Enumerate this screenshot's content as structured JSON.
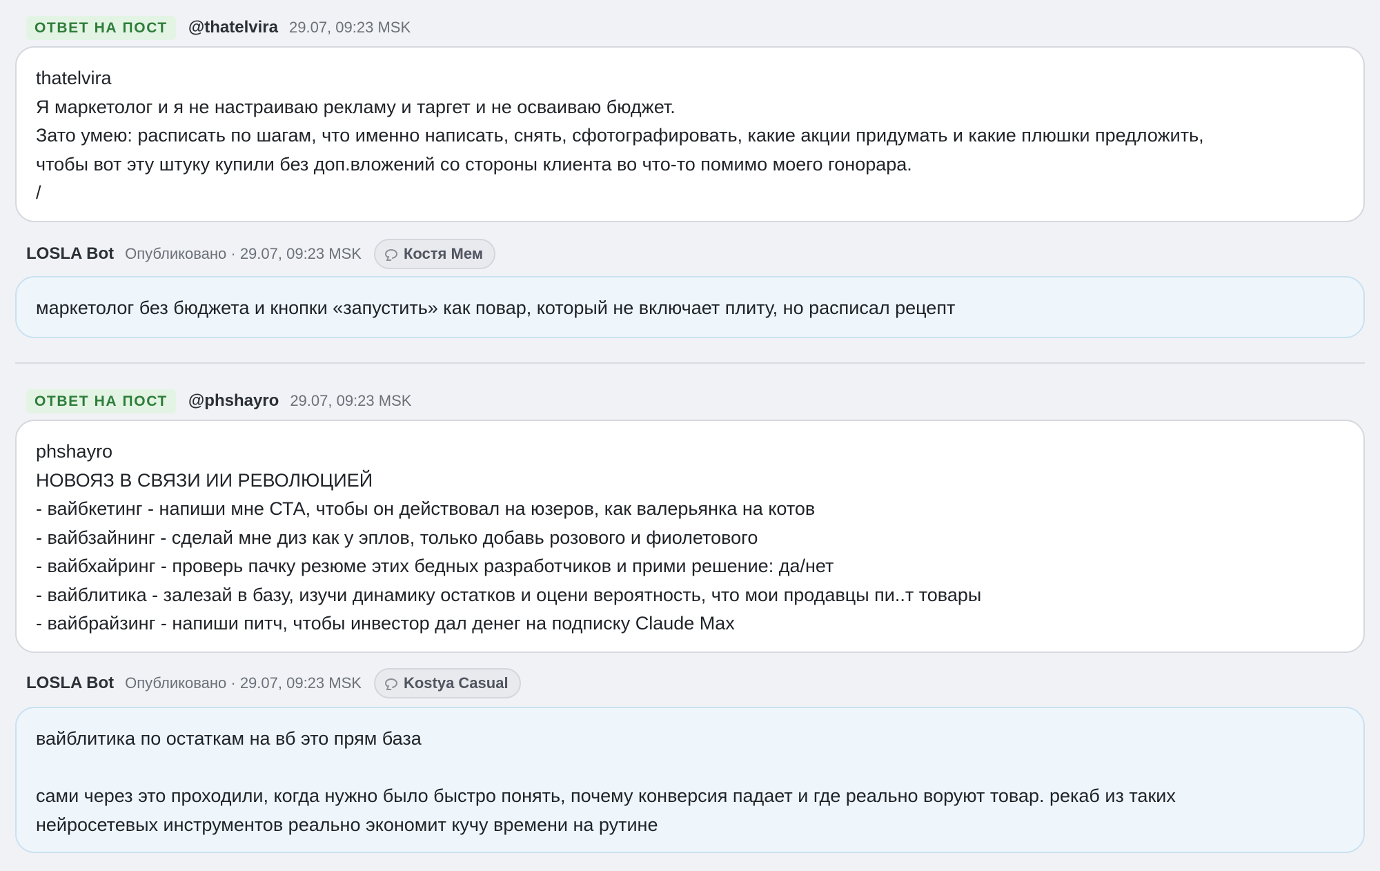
{
  "threads": [
    {
      "post": {
        "tag": "ОТВЕТ НА ПОСТ",
        "handle": "@thatelvira",
        "time": "29.07, 09:23 MSK",
        "lines": [
          "thatelvira",
          "Я маркетолог и я не настраиваю рекламу и таргет и не осваиваю бюджет.",
          "Зато умею: расписать по шагам, что именно написать, снять, сфотографировать, какие акции придумать и какие плюшки предложить,",
          "чтобы вот эту штуку купили без доп.вложений со стороны клиента во что-то помимо моего гонорара.",
          "/"
        ]
      },
      "reply": {
        "bot_name": "LOSLA Bot",
        "meta": "Опубликовано · 29.07, 09:23 MSK",
        "persona": "Костя Мем",
        "persona_icon": "chat-bubble-icon",
        "lines": [
          "маркетолог без бюджета и кнопки «запустить» как повар, который не включает плиту, но расписал рецепт"
        ]
      }
    },
    {
      "post": {
        "tag": "ОТВЕТ НА ПОСТ",
        "handle": "@phshayro",
        "time": "29.07, 09:23 MSK",
        "lines": [
          "phshayro",
          "НОВОЯЗ В СВЯЗИ ИИ РЕВОЛЮЦИЕЙ",
          "- вайбкетинг - напиши мне СТА, чтобы он действовал на юзеров, как валерьянка на котов",
          "- вайбзайнинг - сделай мне диз как у эплов, только добавь розового и фиолетового",
          "- вайбхайринг - проверь пачку резюме этих бедных разработчиков и прими решение: да/нет",
          "- вайблитика - залезай в базу, изучи динамику остатков и оцени вероятность, что мои продавцы пи..т товары",
          "- вайбрайзинг - напиши питч, чтобы инвестор дал денег на подписку Claude Max"
        ]
      },
      "reply": {
        "bot_name": "LOSLA Bot",
        "meta": "Опубликовано · 29.07, 09:23 MSK",
        "persona": "Kostya Casual",
        "persona_icon": "chat-bubble-icon",
        "lines": [
          "вайблитика по остаткам на вб это прям база",
          "",
          "сами через это проходили, когда нужно было быстро понять, почему конверсия падает и где реально воруют товар. рекаб из таких",
          "нейросетевых инструментов реально экономит кучу времени на рутине"
        ]
      }
    }
  ],
  "colors": {
    "page_bg": "#f1f2f5",
    "tag_bg": "#e3f4e4",
    "tag_text": "#2e7d3a",
    "post_card_bg": "#ffffff",
    "reply_card_bg": "#eef6fc",
    "reply_card_border": "#c9e1f1"
  }
}
